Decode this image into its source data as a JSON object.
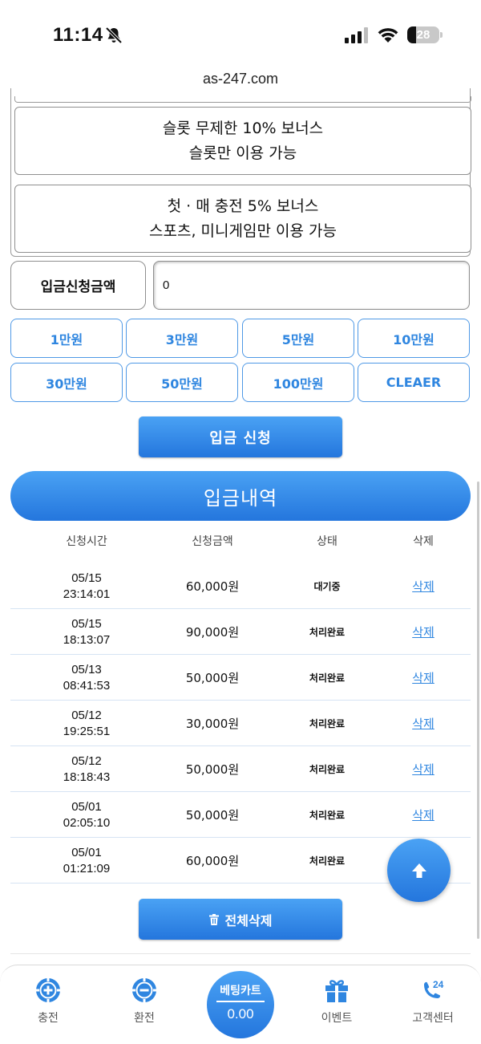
{
  "status_bar": {
    "time": "11:14",
    "battery": "28",
    "battery_level": 0.28
  },
  "browser": {
    "url": "as-247.com"
  },
  "bonuses": [
    {
      "line1": "슬롯 무제한 10% 보너스",
      "line2": "슬롯만 이용 가능"
    },
    {
      "line1": "첫 · 매 충전 5% 보너스",
      "line2": "스포츠, 미니게임만 이용 가능"
    }
  ],
  "amount": {
    "label": "입금신청금액",
    "value": "0"
  },
  "quick_amounts": [
    "1만원",
    "3만원",
    "5만원",
    "10만원",
    "30만원",
    "50만원",
    "100만원",
    "CLEAER"
  ],
  "apply_label": "입금 신청",
  "history": {
    "title": "입금내역",
    "columns": [
      "신청시간",
      "신청금액",
      "상태",
      "삭제"
    ],
    "rows": [
      {
        "date": "05/15",
        "time": "23:14:01",
        "amount": "60,000원",
        "status": "대기중",
        "delete": "삭제"
      },
      {
        "date": "05/15",
        "time": "18:13:07",
        "amount": "90,000원",
        "status": "처리완료",
        "delete": "삭제"
      },
      {
        "date": "05/13",
        "time": "08:41:53",
        "amount": "50,000원",
        "status": "처리완료",
        "delete": "삭제"
      },
      {
        "date": "05/12",
        "time": "19:25:51",
        "amount": "30,000원",
        "status": "처리완료",
        "delete": "삭제"
      },
      {
        "date": "05/12",
        "time": "18:18:43",
        "amount": "50,000원",
        "status": "처리완료",
        "delete": "삭제"
      },
      {
        "date": "05/01",
        "time": "02:05:10",
        "amount": "50,000원",
        "status": "처리완료",
        "delete": "삭제"
      },
      {
        "date": "05/01",
        "time": "01:21:09",
        "amount": "60,000원",
        "status": "처리완료",
        "delete": ""
      }
    ],
    "delete_all_label": "전체삭제"
  },
  "nav": {
    "charge": "충전",
    "exchange": "환전",
    "bet_cart_label": "베팅카트",
    "bet_cart_value": "0.00",
    "event": "이벤트",
    "support": "고객센터",
    "support_badge": "24"
  },
  "colors": {
    "accent": "#2f86e0",
    "gradient_top": "#4aa2f4",
    "gradient_bottom": "#2476dd"
  },
  "icons": [
    "bell-slash-icon",
    "signal-icon",
    "wifi-icon",
    "trash-icon",
    "arrow-up-icon",
    "plus-chip-icon",
    "minus-chip-icon",
    "gift-icon",
    "phone-24-icon"
  ]
}
